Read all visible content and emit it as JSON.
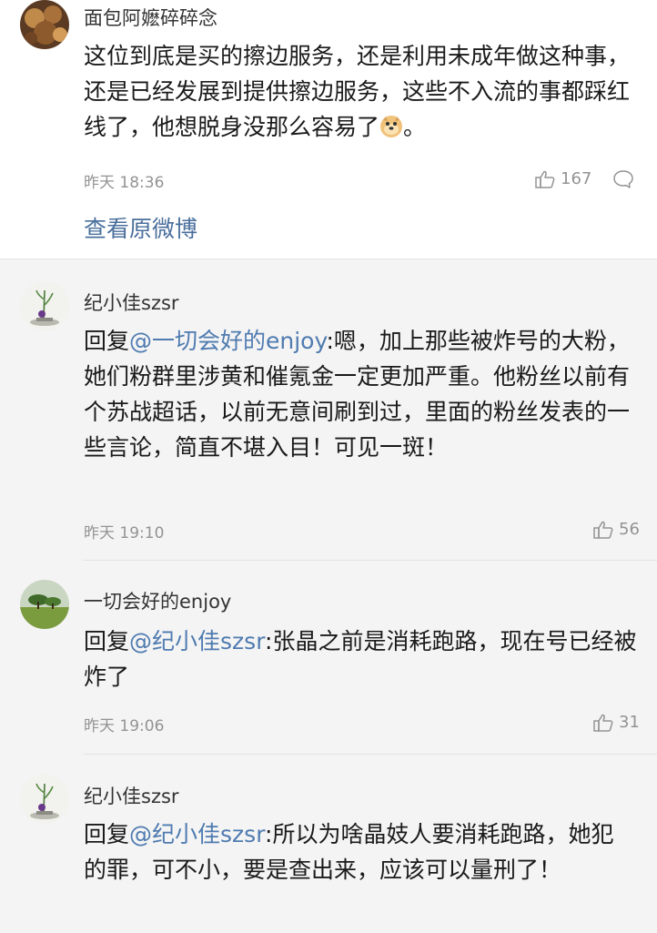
{
  "main_comment": {
    "username": "面包阿嬷碎碎念",
    "text": "这位到底是买的擦边服务，还是利用未成年做这种事，还是已经发展到提供擦边服务，这些不入流的事都踩红线了，他想脱身没那么容易了",
    "emoji": "doge-emoji",
    "text_end": "。",
    "time": "昨天 18:36",
    "likes": "167",
    "view_original": "查看原微博"
  },
  "replies": [
    {
      "username": "纪小佳szsr",
      "reply_prefix": "回复",
      "mention": "@一切会好的enjoy",
      "text": ":嗯，加上那些被炸号的大粉，她们粉群里涉黄和催氪金一定更加严重。他粉丝以前有个苏战超话，以前无意间刷到过，里面的粉丝发表的一些言论，简直不堪入目！可见一斑！",
      "time": "昨天 19:10",
      "likes": "56"
    },
    {
      "username": "一切会好的enjoy",
      "reply_prefix": "回复",
      "mention": "@纪小佳szsr",
      "text": ":张晶之前是消耗跑路，现在号已经被炸了",
      "time": "昨天 19:06",
      "likes": "31"
    },
    {
      "username": "纪小佳szsr",
      "reply_prefix": "回复",
      "mention": "@纪小佳szsr",
      "text": ":所以为啥晶妓人要消耗跑路，她犯的罪，可不小，要是查出来，应该可以量刑了！",
      "time": "",
      "likes": ""
    }
  ],
  "colors": {
    "link": "#4a6f9c",
    "mention": "#4f7bb0",
    "meta": "#939393",
    "reply_bg": "#f4f4f4"
  }
}
